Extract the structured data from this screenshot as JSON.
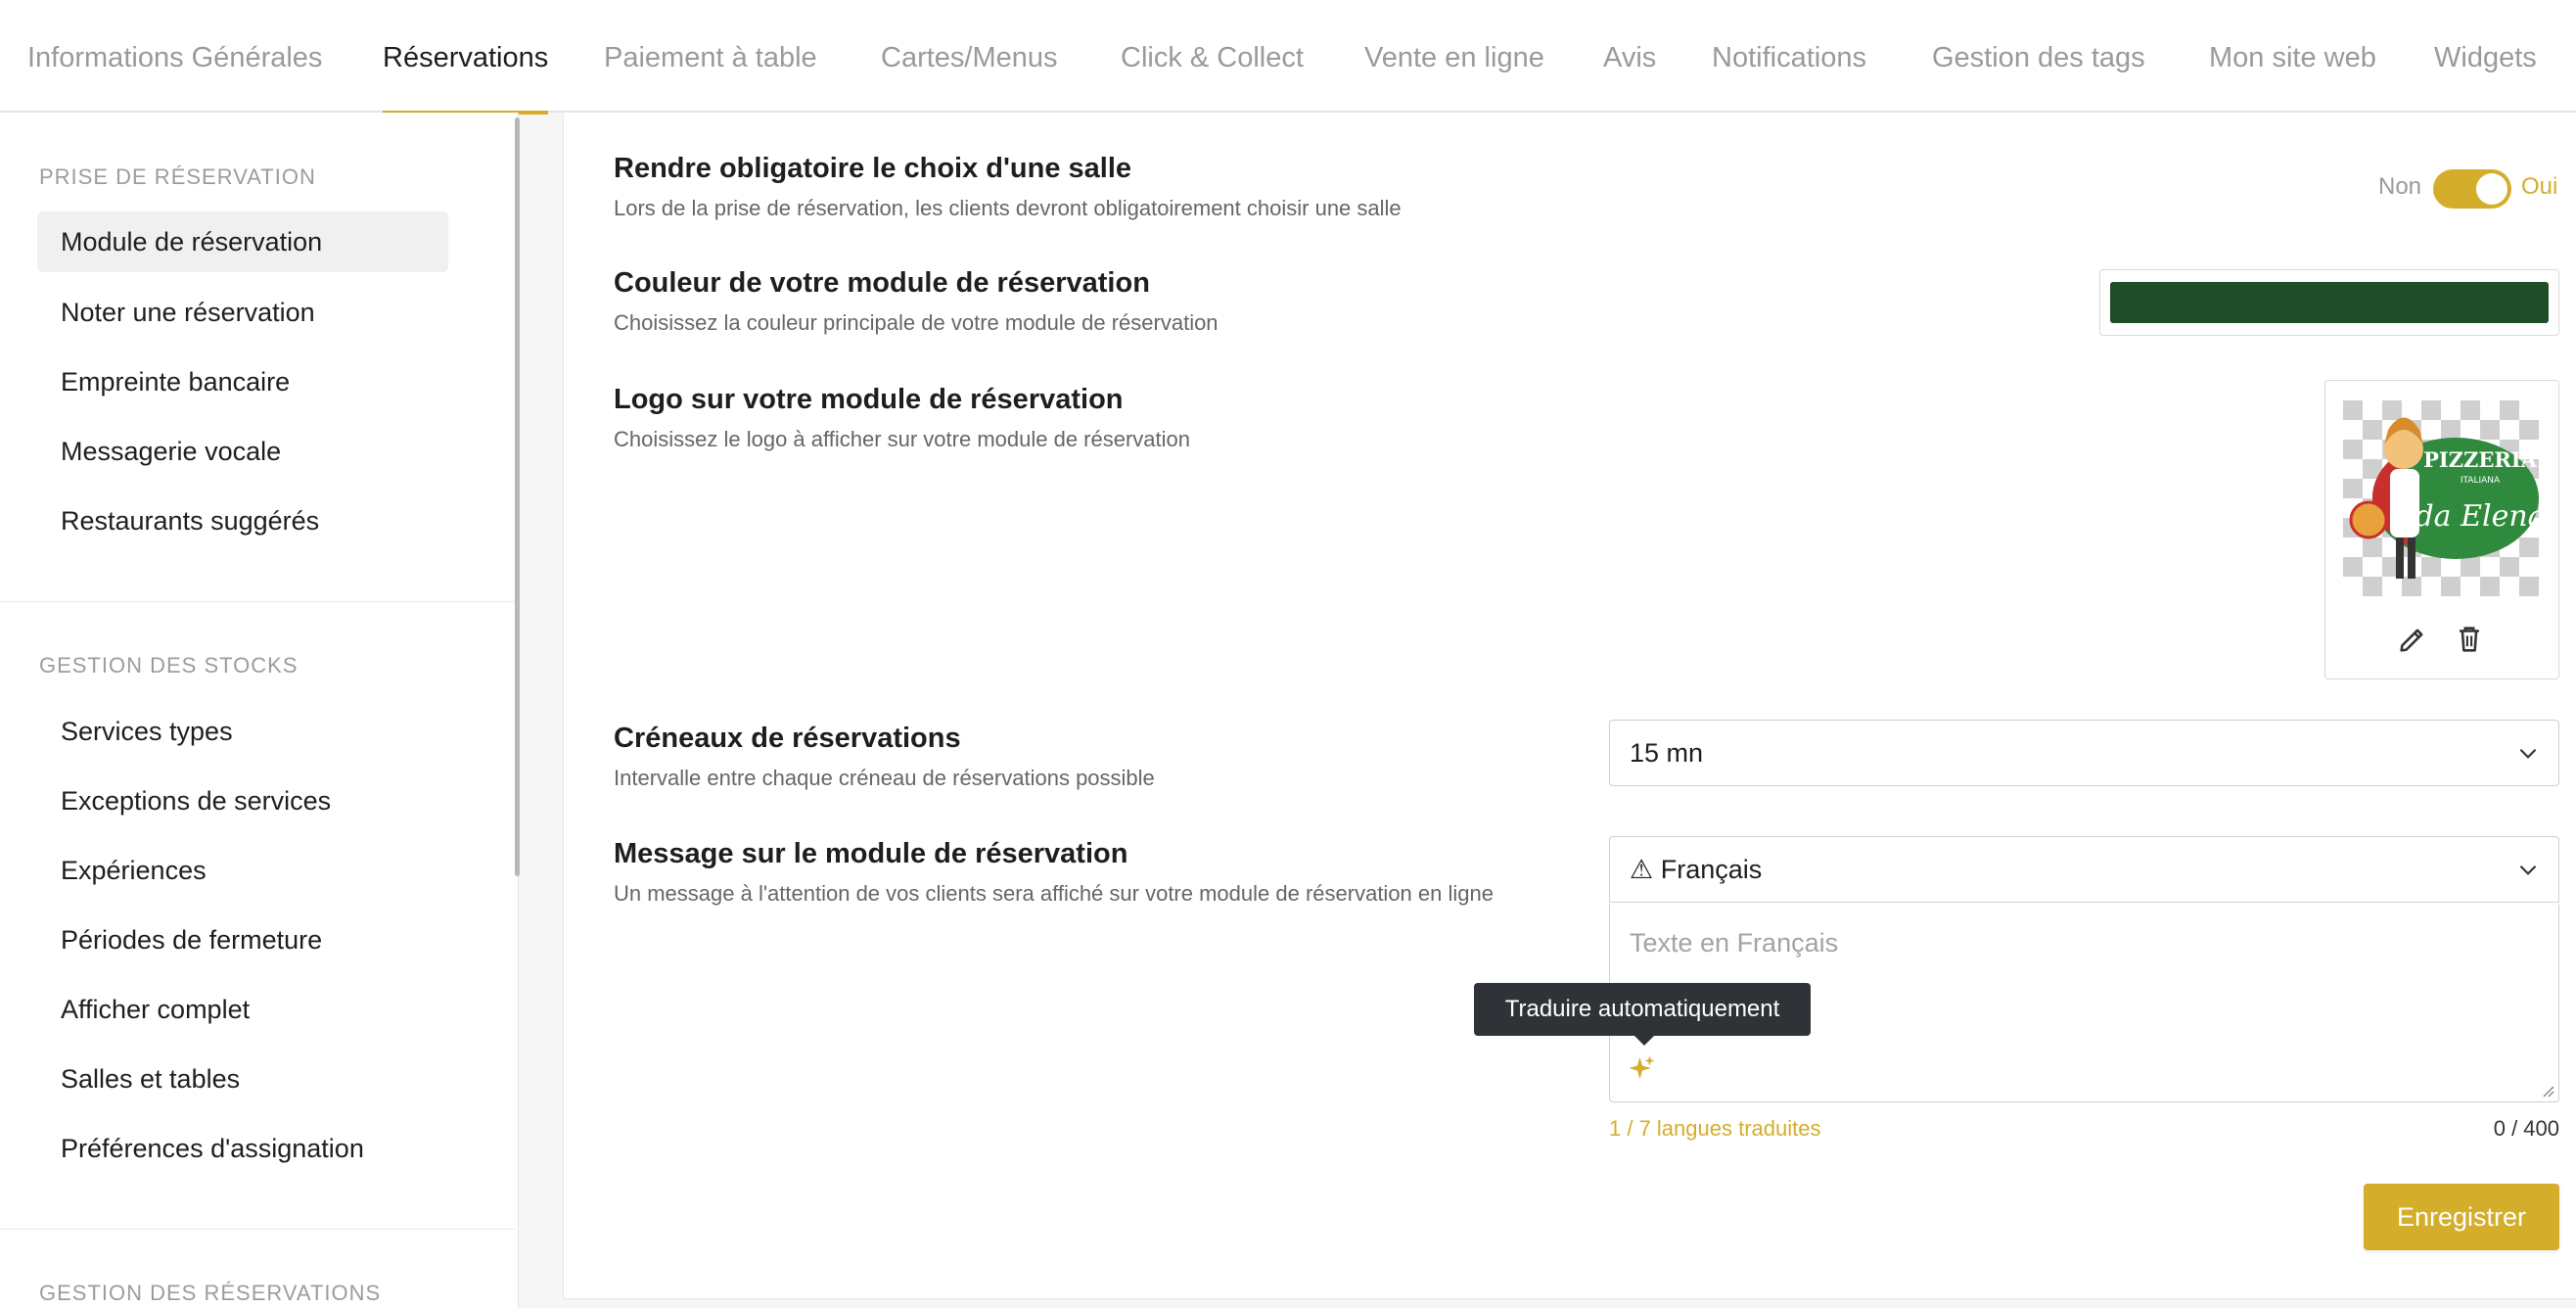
{
  "tabs": [
    {
      "label": "Informations Générales"
    },
    {
      "label": "Réservations",
      "active": true
    },
    {
      "label": "Paiement à table"
    },
    {
      "label": "Cartes/Menus"
    },
    {
      "label": "Click & Collect"
    },
    {
      "label": "Vente en ligne"
    },
    {
      "label": "Avis"
    },
    {
      "label": "Notifications"
    },
    {
      "label": "Gestion des tags"
    },
    {
      "label": "Mon site web"
    },
    {
      "label": "Widgets"
    }
  ],
  "sidebar": {
    "sections": [
      {
        "heading": "PRISE DE RÉSERVATION",
        "items": [
          {
            "label": "Module de réservation",
            "active": true
          },
          {
            "label": "Noter une réservation"
          },
          {
            "label": "Empreinte bancaire"
          },
          {
            "label": "Messagerie vocale"
          },
          {
            "label": "Restaurants suggérés"
          }
        ]
      },
      {
        "heading": "GESTION DES STOCKS",
        "items": [
          {
            "label": "Services types"
          },
          {
            "label": "Exceptions de services"
          },
          {
            "label": "Expériences"
          },
          {
            "label": "Périodes de fermeture"
          },
          {
            "label": "Afficher complet"
          },
          {
            "label": "Salles et tables"
          },
          {
            "label": "Préférences d'assignation"
          }
        ]
      },
      {
        "heading": "GESTION DES RÉSERVATIONS",
        "items": []
      }
    ]
  },
  "settings": {
    "room_choice": {
      "title": "Rendre obligatoire le choix d'une salle",
      "desc": "Lors de la prise de réservation, les clients devront obligatoirement choisir une salle",
      "off_label": "Non",
      "on_label": "Oui",
      "enabled": true
    },
    "color": {
      "title": "Couleur de votre module de réservation",
      "desc": "Choisissez la couleur principale de votre module de réservation",
      "value": "#1f4d2a"
    },
    "logo": {
      "title": "Logo sur votre module de réservation",
      "desc": "Choisissez le logo à afficher sur votre module de réservation",
      "logo_text_top": "PIZZERIA",
      "logo_text_mid": "ITALIANA",
      "logo_text_script": "da Elena"
    },
    "slots": {
      "title": "Créneaux de réservations",
      "desc": "Intervalle entre chaque créneau de réservations possible",
      "value": "15 mn"
    },
    "message": {
      "title": "Message sur le module de réservation",
      "desc": "Un message à l'attention de vos clients sera affiché sur votre module de réservation en ligne",
      "language": "⚠ Français",
      "placeholder": "Texte en Français",
      "tooltip": "Traduire automatiquement",
      "translated": "1 / 7 langues traduites",
      "counter": "0 / 400"
    }
  },
  "save_label": "Enregistrer",
  "colors": {
    "accent": "#d4ad2a",
    "module_color": "#1f4d2a"
  }
}
